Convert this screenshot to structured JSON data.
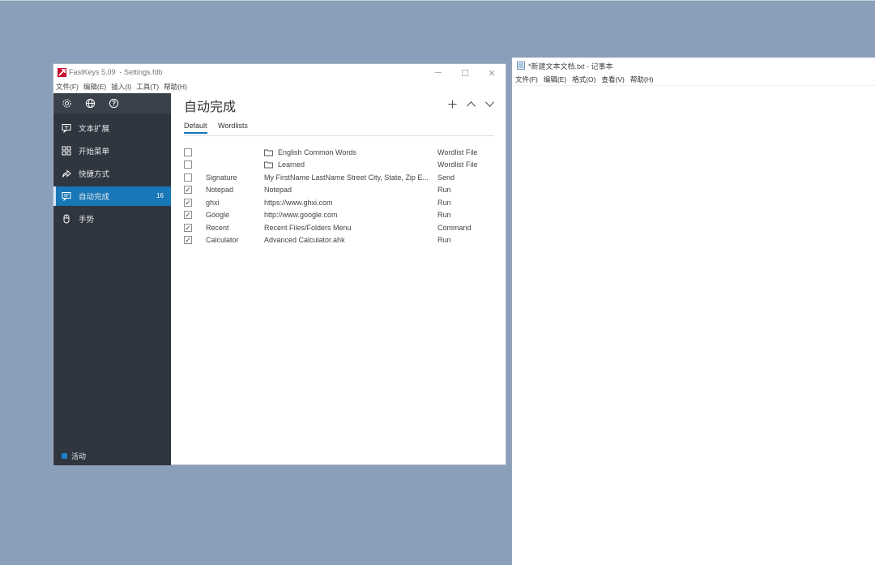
{
  "colors": {
    "desktop": "#8a9fb9",
    "sidebar": "#2f3640",
    "accent": "#1777b7"
  },
  "fastkeys": {
    "title": "FastKeys 5.09  - Settings.fdb",
    "window_controls": [
      "minimize-icon",
      "maximize-icon",
      "close-icon"
    ],
    "menu": [
      "文件(F)",
      "编辑(E)",
      "插入(I)",
      "工具(T)",
      "帮助(H)"
    ],
    "sidebar": {
      "tools": [
        "gear-icon",
        "globe-icon",
        "help-icon"
      ],
      "items": [
        {
          "label": "文本扩展",
          "icon": "text-expand-icon",
          "badge": ""
        },
        {
          "label": "开始菜单",
          "icon": "grid-icon",
          "badge": ""
        },
        {
          "label": "快捷方式",
          "icon": "share-arrow-icon",
          "badge": ""
        },
        {
          "label": "自动完成",
          "icon": "autocomplete-icon",
          "badge": "16",
          "active": true
        },
        {
          "label": "手势",
          "icon": "mouse-icon",
          "badge": ""
        }
      ],
      "status_label": "活动"
    },
    "main": {
      "title": "自动完成",
      "header_icons": [
        "add-icon",
        "move-up-icon",
        "move-down-icon"
      ],
      "tabs": [
        "Default",
        "Wordlists"
      ],
      "rows": [
        {
          "checked": false,
          "name": "",
          "folder": true,
          "value": "English Common Words",
          "type": "Wordlist File"
        },
        {
          "checked": false,
          "name": "",
          "folder": true,
          "value": "Learned",
          "type": "Wordlist File"
        },
        {
          "checked": false,
          "name": "Signature",
          "folder": false,
          "value": "My FirstName LastName Street City, State, Zip E...",
          "type": "Send"
        },
        {
          "checked": true,
          "name": "Notepad",
          "folder": false,
          "value": "Notepad",
          "type": "Run"
        },
        {
          "checked": true,
          "name": "ghxi",
          "folder": false,
          "value": "https://www.ghxi.com",
          "type": "Run"
        },
        {
          "checked": true,
          "name": "Google",
          "folder": false,
          "value": "http://www.google.com",
          "type": "Run"
        },
        {
          "checked": true,
          "name": "Recent",
          "folder": false,
          "value": "Recent Files/Folders Menu",
          "type": "Command"
        },
        {
          "checked": true,
          "name": "Calculator",
          "folder": false,
          "value": "Advanced Calculator.ahk",
          "type": "Run"
        }
      ]
    }
  },
  "notepad": {
    "title": "*新建文本文档.txt - 记事本",
    "menu": [
      "文件(F)",
      "编辑(E)",
      "格式(O)",
      "查看(V)",
      "帮助(H)"
    ],
    "content": ""
  }
}
